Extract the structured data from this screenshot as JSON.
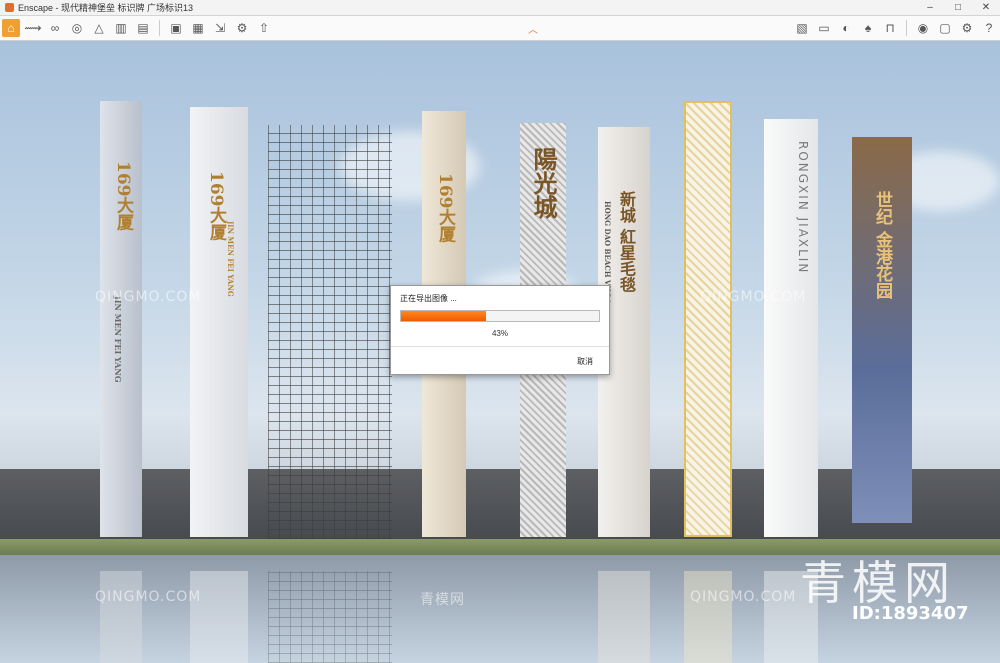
{
  "window": {
    "title": "Enscape - 现代精神堡垒 标识牌 广场标识13",
    "minimize": "–",
    "maximize": "□",
    "close": "✕"
  },
  "toolbar": {
    "left_icons": [
      "home-icon",
      "paths-icon",
      "glasses-icon",
      "map-pin-icon",
      "nav-icon",
      "buildings-icon",
      "clipboard-icon",
      "screenshot-icon",
      "batch-render-icon",
      "export-icon",
      "settings-icon",
      "upload-icon"
    ],
    "collapse_glyph": "︿",
    "right_icons": [
      "asset-library-icon",
      "monitor-icon",
      "sun-icon",
      "material-icon",
      "chair-icon",
      "eye-icon",
      "vr-icon",
      "gear-icon",
      "help-icon"
    ]
  },
  "dialog": {
    "title": "正在导出图像 ...",
    "progress": 43,
    "percent_label": "43%",
    "cancel_label": "取消"
  },
  "signs": {
    "s1": "169大厦",
    "s1_en": "JIN MEN FEI YANG",
    "s2": "169大厦",
    "s2_en": "JIN MEN FEI YANG",
    "s4": "169大厦",
    "s5": "陽光城",
    "s6": "新城 紅星毛毯",
    "s6_en": "HONG DAO BEACH VILLA",
    "s8": "RONGXIN JIAXLIN",
    "s9": "世纪 金港花园"
  },
  "watermarks": {
    "site": "QINGMO.COM",
    "site_cn": "青模网",
    "brand": "青模网",
    "id": "ID:1893407"
  }
}
